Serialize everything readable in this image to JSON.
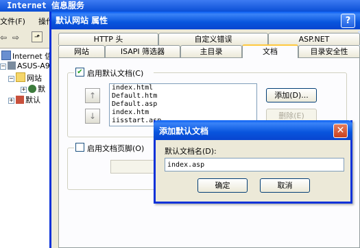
{
  "bg_window": {
    "title": "Internet 信息服务",
    "menu": [
      "文件(F)",
      "操作"
    ],
    "tree": [
      "Internet 信",
      "ASUS-A9",
      "网站",
      "默",
      "默认"
    ]
  },
  "props_dialog": {
    "title": "默认网站 属性",
    "help": "?",
    "tabs_row1": [
      "HTTP 头",
      "自定义错误",
      "ASP.NET"
    ],
    "tabs_row2": [
      "网站",
      "ISAPI 筛选器",
      "主目录",
      "文档",
      "目录安全性"
    ],
    "enable_default_doc": "启用默认文档(C)",
    "doc_list": [
      "index.html",
      "Default.htm",
      "Default.asp",
      "index.htm",
      "iisstart.asp"
    ],
    "add_button": "添加(D)...",
    "remove_button": "删除(E)",
    "move_up": "↑",
    "move_down": "↓",
    "enable_footer": "启用文档页脚(O)"
  },
  "add_dialog": {
    "title": "添加默认文档",
    "field_label": "默认文档名(D):",
    "field_value": "index.asp",
    "ok_button": "确定",
    "cancel_button": "取消",
    "close": "✕"
  }
}
